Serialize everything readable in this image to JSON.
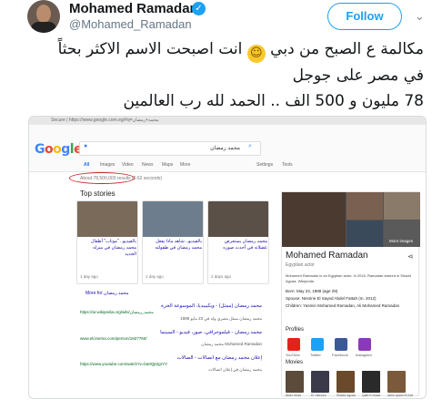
{
  "tweet": {
    "display_name": "Mohamed Ramadan",
    "handle": "@Mohamed_Ramadan",
    "follow_label": "Follow",
    "verified_glyph": "✓",
    "line1": "مكالمة ع الصبح من دبي",
    "line1_b": "انت اصبحت الاسم الاكثر بحثاً",
    "line2": "في مصر على جوجل",
    "line3": "78 مليون و 500 الف .. الحمد لله رب العالمين",
    "emoji_glyph": "😄"
  },
  "screenshot": {
    "url_text": "Secure | https://www.google.com.eg/#q=محمد+رمضان",
    "logo": [
      {
        "ch": "G",
        "color": "#4285f4"
      },
      {
        "ch": "o",
        "color": "#ea4335"
      },
      {
        "ch": "o",
        "color": "#fbbc05"
      },
      {
        "ch": "g",
        "color": "#4285f4"
      },
      {
        "ch": "l",
        "color": "#34a853"
      },
      {
        "ch": "e",
        "color": "#ea4335"
      }
    ],
    "search_query": "محمد رمضان",
    "tabs": [
      "All",
      "Images",
      "Video",
      "News",
      "Maps",
      "More"
    ],
    "tools": [
      "Settings",
      "Tools"
    ],
    "about": "About 78,500,000 results (0.62 seconds)",
    "top_stories": "Top stories",
    "cards": [
      {
        "title": "بالفيديو.. \"موتاب\" أطفال محمد رمضان في منزله الجديد",
        "meta": "1 day ago",
        "color": "#7a6a5a"
      },
      {
        "title": "بالفيديو.. شاهد ماذا يفعل محمد رمضان في طفولته",
        "meta": "1 day ago",
        "color": "#6d7d8d"
      },
      {
        "title": "محمد رمضان يستعرض عضلاته في أحدث صوره",
        "meta": "2 days ago",
        "color": "#5a5048"
      }
    ],
    "more_news": "More for محمد رمضان",
    "results": [
      {
        "title": "محمد رمضان (ممثل) - ويكيبيديا، الموسوعة الحرة",
        "url": "https://ar.wikipedia.org/wiki/محمد_رمضان",
        "snippet": "محمد رمضان ممثل مصري ولد في 23 مايو 1988"
      },
      {
        "title": "محمد رمضان - فيلموجرافي، صور، فيديو - السينما",
        "url": "www.elcinema.com/person/1927760/",
        "snippet": "Mohamed Ramadan محمد رمضان"
      },
      {
        "title": "إعلان محمد رمضان مع اتصالات - الصالات",
        "url": "https://www.youtube.com/watch?v=ba0Qjt2grYY",
        "snippet": "محمد رمضان في إعلان اتصالات"
      }
    ],
    "kp": {
      "name": "Mohamed Ramadan",
      "subtitle": "Egyptian actor",
      "more_images": "More images",
      "desc": "Mohamed Ramadan is an Egyptian actor. In 2015, Ramadan starred in Shadd Agzaa. Wikipedia",
      "facts": [
        "Born: May 23, 1988 (age 29)",
        "Spouse: Nesrine El Sayed Abdel Fattah (m. 2012)",
        "Children: Yasmin Mohamed Ramadan, Ali Mohamed Ramadan"
      ],
      "profiles_label": "Profiles",
      "profiles": [
        {
          "name": "YouTube",
          "color": "#e62117"
        },
        {
          "name": "Twitter",
          "color": "#1da1f2"
        },
        {
          "name": "Facebook",
          "color": "#3b5998"
        },
        {
          "name": "Instagram",
          "color": "#8a3ab9"
        }
      ],
      "movies_label": "Movies",
      "movies": [
        {
          "name": "Abdo Mota",
          "color": "#5c4a3a"
        },
        {
          "name": "El Ostoora",
          "color": "#3a3a4a"
        },
        {
          "name": "Shadd Agzaa",
          "color": "#6a4a2a"
        },
        {
          "name": "Qalb El Asad",
          "color": "#2a2a2a"
        },
        {
          "name": "Akhir Ayam El Ard",
          "color": "#7a5a3a"
        }
      ]
    }
  }
}
